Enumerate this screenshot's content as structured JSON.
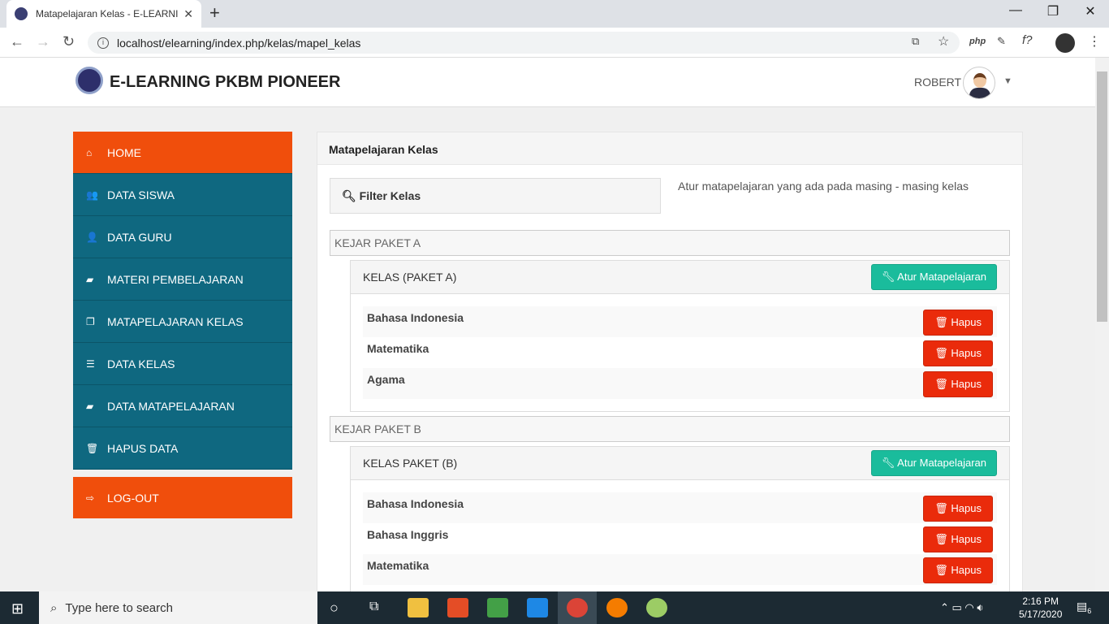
{
  "browser": {
    "tab_title": "Matapelajaran Kelas - E-LEARNIN",
    "url": "localhost/elearning/index.php/kelas/mapel_kelas",
    "ext_php": "php",
    "ext_f": "f?"
  },
  "header": {
    "brand": "E-LEARNING PKBM PIONEER",
    "user": "ROBERT"
  },
  "sidebar": {
    "items": [
      {
        "label": "HOME",
        "icon": "home-icon",
        "glyph": "⌂"
      },
      {
        "label": "DATA SISWA",
        "icon": "users-icon",
        "glyph": "👥"
      },
      {
        "label": "DATA GURU",
        "icon": "user-icon",
        "glyph": "👤"
      },
      {
        "label": "MATERI PEMBELAJARAN",
        "icon": "book-icon",
        "glyph": "▰"
      },
      {
        "label": "MATAPELAJARAN KELAS",
        "icon": "copy-icon",
        "glyph": "❐"
      },
      {
        "label": "DATA KELAS",
        "icon": "list-icon",
        "glyph": "☰"
      },
      {
        "label": "DATA MATAPELAJARAN",
        "icon": "book-icon",
        "glyph": "▰"
      },
      {
        "label": "HAPUS DATA",
        "icon": "trash-icon",
        "glyph": "🗑"
      }
    ],
    "logout": "LOG-OUT"
  },
  "main": {
    "title": "Matapelajaran Kelas",
    "filter_label": "Filter Kelas",
    "description": "Atur matapelajaran yang ada pada masing - masing kelas",
    "atur_label": "Atur Matapelajaran",
    "hapus_label": "Hapus",
    "groups": [
      {
        "paket": "KEJAR PAKET A",
        "kelas": "KELAS (PAKET A)",
        "subjects": [
          "Bahasa Indonesia",
          "Matematika",
          "Agama"
        ]
      },
      {
        "paket": "KEJAR PAKET B",
        "kelas": "KELAS PAKET (B)",
        "subjects": [
          "Bahasa Indonesia",
          "Bahasa Inggris",
          "Matematika"
        ]
      }
    ]
  },
  "taskbar": {
    "search_placeholder": "Type here to search",
    "time": "2:16 PM",
    "date": "5/17/2020",
    "notifications": "6"
  },
  "colors": {
    "accent_orange": "#f04e0c",
    "sidebar_teal": "#0f6880",
    "button_green": "#1abc9c",
    "button_red": "#ea2b0b"
  }
}
